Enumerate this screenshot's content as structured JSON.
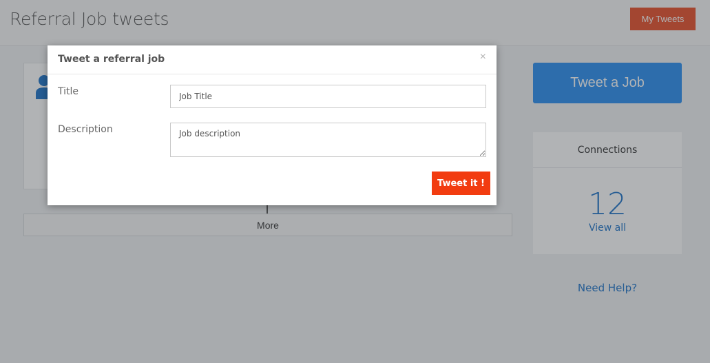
{
  "header": {
    "title": "Referral Job tweets",
    "my_tweets_label": "My Tweets"
  },
  "main": {
    "more_label": "More"
  },
  "sidebar": {
    "tweet_job_label": "Tweet a Job",
    "connections": {
      "heading": "Connections",
      "count": "12",
      "view_all_label": "View all"
    },
    "need_help_label": "Need Help?"
  },
  "modal": {
    "title": "Tweet a referral job",
    "close_glyph": "×",
    "title_label": "Title",
    "title_placeholder": "Job Title",
    "description_label": "Description",
    "description_placeholder": "Job description",
    "submit_label": "Tweet it !"
  },
  "colors": {
    "accent_orange": "#e8502a",
    "submit_red": "#f23c10",
    "primary_blue": "#2b8ef0",
    "link_blue": "#1e73c8"
  },
  "icons": [
    "user-icon",
    "close-icon"
  ]
}
